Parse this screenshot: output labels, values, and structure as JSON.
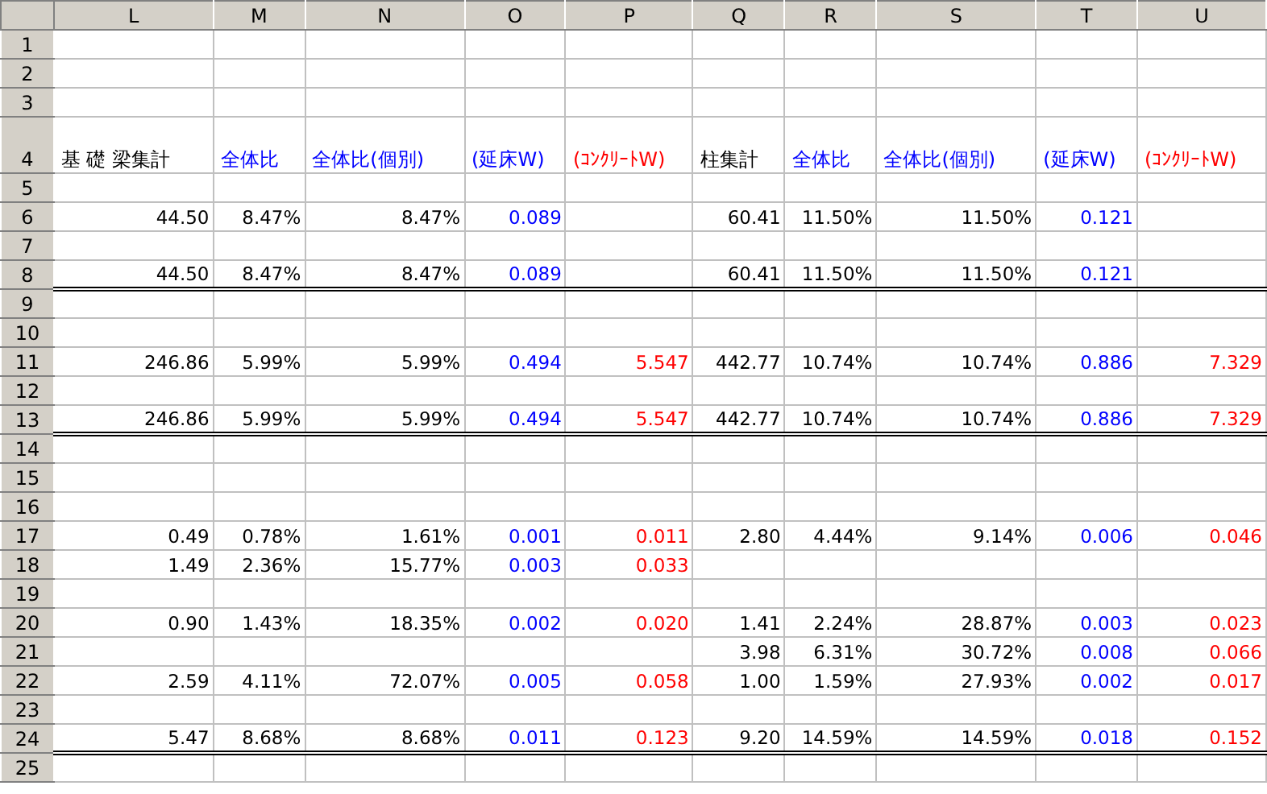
{
  "columns": [
    {
      "letter": "L",
      "color": "#000000"
    },
    {
      "letter": "M",
      "color": "#000000"
    },
    {
      "letter": "N",
      "color": "#000000"
    },
    {
      "letter": "O",
      "color": "#0000ff"
    },
    {
      "letter": "P",
      "color": "#ff0000"
    },
    {
      "letter": "Q",
      "color": "#000000"
    },
    {
      "letter": "R",
      "color": "#000000"
    },
    {
      "letter": "S",
      "color": "#000000"
    },
    {
      "letter": "T",
      "color": "#0000ff"
    },
    {
      "letter": "U",
      "color": "#ff0000"
    }
  ],
  "rows": [
    {
      "number": "1",
      "double_rule_below": false,
      "cells": {}
    },
    {
      "number": "2",
      "double_rule_below": false,
      "cells": {}
    },
    {
      "number": "3",
      "double_rule_below": false,
      "cells": {}
    },
    {
      "number": "4",
      "double_rule_below": false,
      "kind": "heading",
      "headings": {
        "L": {
          "text": "基 礎 梁集計",
          "color": "#000000"
        },
        "M": {
          "text": "全体比",
          "color": "#0000ff"
        },
        "N": {
          "text": "全体比(個別)",
          "color": "#0000ff"
        },
        "O": {
          "text": "(延床W)",
          "color": "#0000ff"
        },
        "P": {
          "text": "(ｺﾝｸﾘｰﾄW)",
          "color": "#ff0000"
        },
        "Q": {
          "text": "柱集計",
          "color": "#000000"
        },
        "R": {
          "text": "全体比",
          "color": "#0000ff"
        },
        "S": {
          "text": "全体比(個別)",
          "color": "#0000ff"
        },
        "T": {
          "text": "(延床W)",
          "color": "#0000ff"
        },
        "U": {
          "text": "(ｺﾝｸﾘｰﾄW)",
          "color": "#ff0000"
        }
      }
    },
    {
      "number": "5",
      "double_rule_below": false,
      "cells": {}
    },
    {
      "number": "6",
      "double_rule_below": false,
      "cells": {
        "L": "44.50",
        "M": "8.47%",
        "N": "8.47%",
        "O": "0.089",
        "Q": "60.41",
        "R": "11.50%",
        "S": "11.50%",
        "T": "0.121"
      }
    },
    {
      "number": "7",
      "double_rule_below": false,
      "cells": {}
    },
    {
      "number": "8",
      "double_rule_below": true,
      "cells": {
        "L": "44.50",
        "M": "8.47%",
        "N": "8.47%",
        "O": "0.089",
        "Q": "60.41",
        "R": "11.50%",
        "S": "11.50%",
        "T": "0.121"
      }
    },
    {
      "number": "9",
      "double_rule_below": false,
      "cells": {}
    },
    {
      "number": "10",
      "double_rule_below": false,
      "cells": {}
    },
    {
      "number": "11",
      "double_rule_below": false,
      "cells": {
        "L": "246.86",
        "M": "5.99%",
        "N": "5.99%",
        "O": "0.494",
        "P": "5.547",
        "Q": "442.77",
        "R": "10.74%",
        "S": "10.74%",
        "T": "0.886",
        "U": "7.329"
      }
    },
    {
      "number": "12",
      "double_rule_below": false,
      "cells": {}
    },
    {
      "number": "13",
      "double_rule_below": true,
      "cells": {
        "L": "246.86",
        "M": "5.99%",
        "N": "5.99%",
        "O": "0.494",
        "P": "5.547",
        "Q": "442.77",
        "R": "10.74%",
        "S": "10.74%",
        "T": "0.886",
        "U": "7.329"
      }
    },
    {
      "number": "14",
      "double_rule_below": false,
      "cells": {}
    },
    {
      "number": "15",
      "double_rule_below": false,
      "cells": {}
    },
    {
      "number": "16",
      "double_rule_below": false,
      "cells": {}
    },
    {
      "number": "17",
      "double_rule_below": false,
      "cells": {
        "L": "0.49",
        "M": "0.78%",
        "N": "1.61%",
        "O": "0.001",
        "P": "0.011",
        "Q": "2.80",
        "R": "4.44%",
        "S": "9.14%",
        "T": "0.006",
        "U": "0.046"
      }
    },
    {
      "number": "18",
      "double_rule_below": false,
      "cells": {
        "L": "1.49",
        "M": "2.36%",
        "N": "15.77%",
        "O": "0.003",
        "P": "0.033"
      }
    },
    {
      "number": "19",
      "double_rule_below": false,
      "cells": {}
    },
    {
      "number": "20",
      "double_rule_below": false,
      "cells": {
        "L": "0.90",
        "M": "1.43%",
        "N": "18.35%",
        "O": "0.002",
        "P": "0.020",
        "Q": "1.41",
        "R": "2.24%",
        "S": "28.87%",
        "T": "0.003",
        "U": "0.023"
      }
    },
    {
      "number": "21",
      "double_rule_below": false,
      "cells": {
        "Q": "3.98",
        "R": "6.31%",
        "S": "30.72%",
        "T": "0.008",
        "U": "0.066"
      }
    },
    {
      "number": "22",
      "double_rule_below": false,
      "cells": {
        "L": "2.59",
        "M": "4.11%",
        "N": "72.07%",
        "O": "0.005",
        "P": "0.058",
        "Q": "1.00",
        "R": "1.59%",
        "S": "27.93%",
        "T": "0.002",
        "U": "0.017"
      }
    },
    {
      "number": "23",
      "double_rule_below": false,
      "cells": {}
    },
    {
      "number": "24",
      "double_rule_below": true,
      "cells": {
        "L": "5.47",
        "M": "8.68%",
        "N": "8.68%",
        "O": "0.011",
        "P": "0.123",
        "Q": "9.20",
        "R": "14.59%",
        "S": "14.59%",
        "T": "0.018",
        "U": "0.152"
      }
    },
    {
      "number": "25",
      "double_rule_below": false,
      "cells": {}
    }
  ]
}
